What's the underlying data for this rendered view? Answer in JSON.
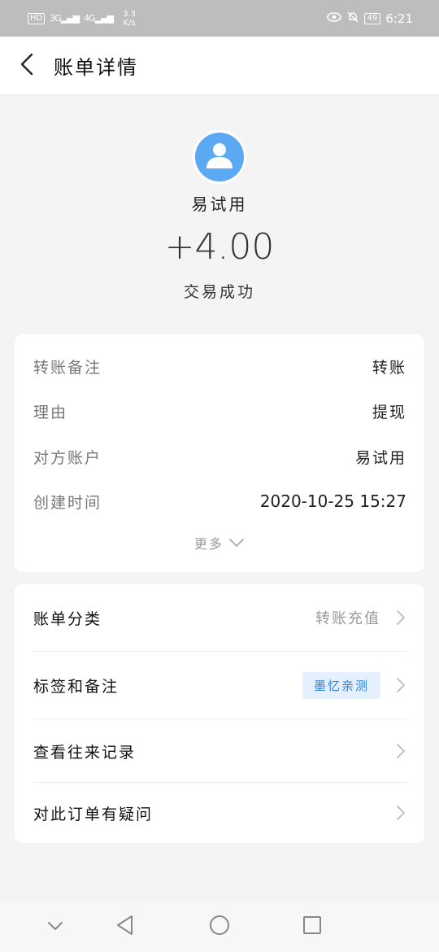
{
  "status_bar": {
    "hd": "HD",
    "signal1": "3G",
    "signal2": "4G",
    "speed_value": "3.3",
    "speed_unit": "K/s",
    "battery": "49",
    "time": "6:21"
  },
  "nav": {
    "title": "账单详情"
  },
  "summary": {
    "name": "易试用",
    "amount": "+4.00",
    "status": "交易成功"
  },
  "details": [
    {
      "label": "转账备注",
      "value": "转账"
    },
    {
      "label": "理由",
      "value": "提现"
    },
    {
      "label": "对方账户",
      "value": "易试用"
    },
    {
      "label": "创建时间",
      "value": "2020-10-25 15:27"
    }
  ],
  "more_label": "更多",
  "actions": [
    {
      "label": "账单分类",
      "value": "转账充值"
    },
    {
      "label": "标签和备注",
      "tag": "墨忆亲测"
    },
    {
      "label": "查看往来记录"
    },
    {
      "label": "对此订单有疑问"
    }
  ],
  "colors": {
    "avatar_bg": "#5aa9f2",
    "tag_bg": "#e4f0fd",
    "tag_text": "#2f7fd8"
  }
}
